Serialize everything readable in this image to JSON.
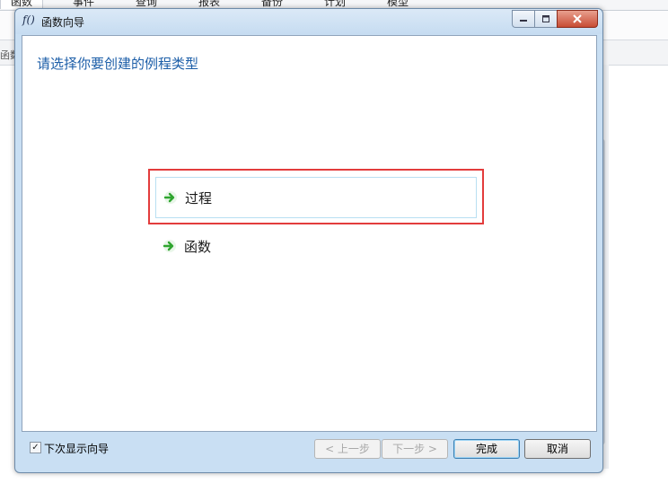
{
  "background_app": {
    "tabs": [
      "函数",
      "事件",
      "查询",
      "报表",
      "备份",
      "计划",
      "模型"
    ],
    "left_label": "函数"
  },
  "dialog": {
    "title_icon": "f()",
    "title": "函数向导",
    "heading": "请选择你要创建的例程类型",
    "options": [
      {
        "label": "过程",
        "icon": "green-arrow-icon"
      },
      {
        "label": "函数",
        "icon": "green-arrow-icon"
      }
    ],
    "checkbox": {
      "label": "下次显示向导",
      "checked": true
    },
    "buttons": {
      "back": "< 上一步",
      "next": "下一步 >",
      "finish": "完成",
      "cancel": "取消"
    }
  },
  "colors": {
    "heading": "#1c5ea8",
    "highlight": "#e33c3c",
    "arrow": "#2fa52f"
  }
}
